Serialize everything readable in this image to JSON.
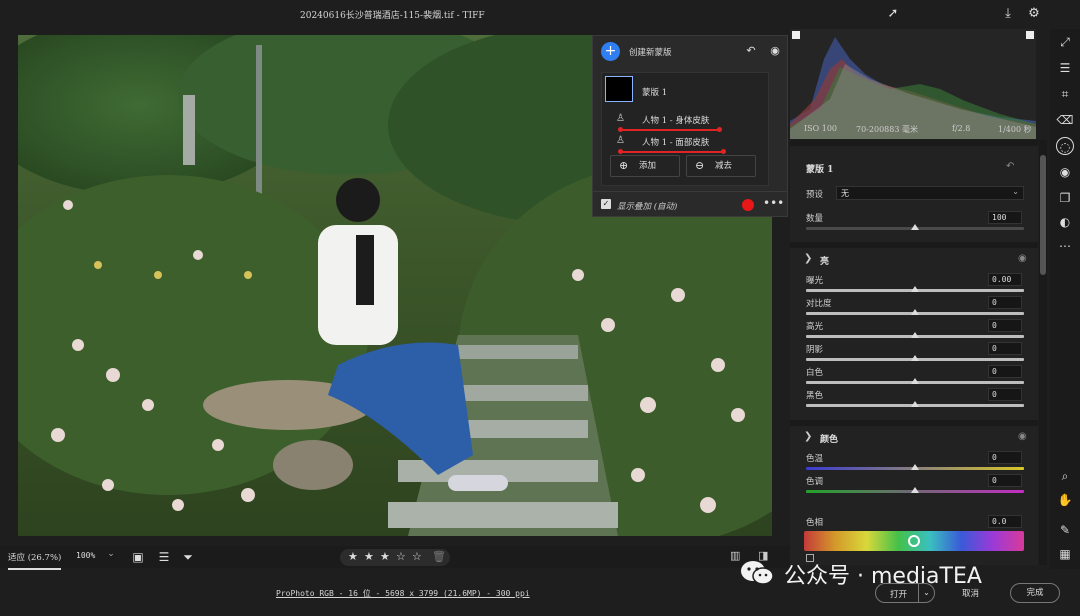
{
  "app": {
    "title": "20240616长沙普瑞酒店-115-裴烟.tif -  TIFF"
  },
  "mask_panel": {
    "create_label": "创建新蒙版",
    "mask_name": "蒙版 1",
    "components": [
      {
        "label": "人物 1 - 身体皮肤"
      },
      {
        "label": "人物 1 - 面部皮肤"
      }
    ],
    "add_label": "添加",
    "subtract_label": "减去",
    "show_overlay_label": "显示叠加 (自动)",
    "overlay_color": "#e81818"
  },
  "exif": {
    "iso": "ISO 100",
    "lens": "70-200883 毫米",
    "aperture": "f/2.8",
    "shutter": "1/400 秒"
  },
  "right_panel": {
    "mask_header": "蒙版 1",
    "preset_label": "预设",
    "preset_value": "无",
    "amount_label": "数量",
    "amount_value": "100",
    "amount_fraction": 0.5,
    "light_title": "亮",
    "light": [
      {
        "label": "曝光",
        "value": "0.00",
        "fraction": 0.5
      },
      {
        "label": "对比度",
        "value": "0",
        "fraction": 0.5
      },
      {
        "label": "高光",
        "value": "0",
        "fraction": 0.5
      },
      {
        "label": "阴影",
        "value": "0",
        "fraction": 0.5
      },
      {
        "label": "白色",
        "value": "0",
        "fraction": 0.5
      },
      {
        "label": "黑色",
        "value": "0",
        "fraction": 0.5
      }
    ],
    "color_title": "颜色",
    "color": [
      {
        "label": "色温",
        "value": "0",
        "fraction": 0.5,
        "gradient": [
          "#3b3bd1",
          "#d9c62a"
        ]
      },
      {
        "label": "色调",
        "value": "0",
        "fraction": 0.5,
        "gradient": [
          "#22a22a",
          "#c42cc4"
        ]
      }
    ],
    "hue_label": "色相",
    "hue_value": "0.0",
    "hue_fraction": 0.5
  },
  "filmstrip": {
    "zoom_fit": "适应 (26.7%)",
    "zoom_100": "100%",
    "rating_stars": 3,
    "max_stars": 5
  },
  "status": {
    "file_info": "ProPhoto RGB - 16 位 - 5698 x 3799 (21.6MP) - 300 ppi",
    "open_label": "打开",
    "cancel_label": "取消",
    "done_label": "完成"
  },
  "watermark": {
    "text": "公众号 · mediaTEA"
  }
}
